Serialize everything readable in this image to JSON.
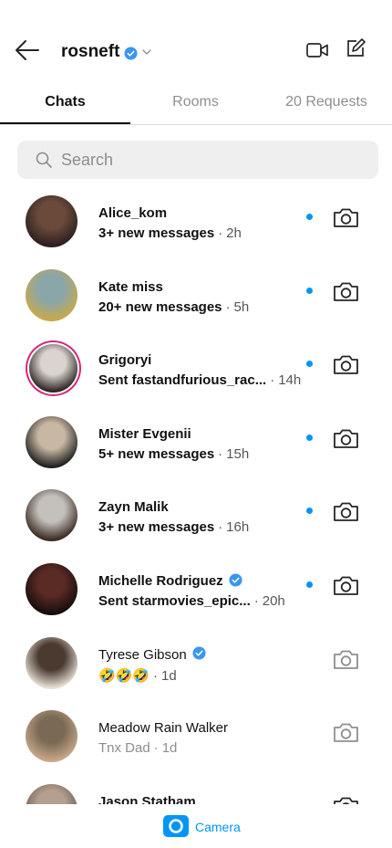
{
  "header": {
    "title": "rosneft",
    "back_icon": "arrow-left-icon",
    "video_icon": "video-camera-icon",
    "compose_icon": "compose-icon"
  },
  "tabs": [
    {
      "label": "Chats",
      "active": true
    },
    {
      "label": "Rooms",
      "active": false
    },
    {
      "label": "20 Requests",
      "active": false
    }
  ],
  "search": {
    "placeholder": "Search",
    "value": ""
  },
  "chats": [
    {
      "name": "Alice_kom",
      "verified": false,
      "preview": "3+ new messages",
      "time": "2h",
      "unread": true,
      "bold": true,
      "story": false,
      "avatar_colors": [
        "#6b4a3a",
        "#2b2020"
      ]
    },
    {
      "name": "Kate miss",
      "verified": false,
      "preview": "20+ new messages",
      "time": "5h",
      "unread": true,
      "bold": true,
      "story": false,
      "avatar_colors": [
        "#8aa6a8",
        "#c9a94a"
      ]
    },
    {
      "name": "Grigoryi",
      "verified": false,
      "preview": "Sent fastandfurious_rac...",
      "time": "14h",
      "unread": true,
      "bold": true,
      "story": true,
      "avatar_colors": [
        "#d9d4d0",
        "#2c2522"
      ]
    },
    {
      "name": "Mister Evgenii",
      "verified": false,
      "preview": "5+ new messages",
      "time": "15h",
      "unread": true,
      "bold": true,
      "story": false,
      "avatar_colors": [
        "#c8b7a3",
        "#1f1f1f"
      ]
    },
    {
      "name": "Zayn Malik",
      "verified": false,
      "preview": "3+ new messages",
      "time": "16h",
      "unread": true,
      "bold": true,
      "story": false,
      "avatar_colors": [
        "#c4c0bc",
        "#3a2a22"
      ]
    },
    {
      "name": "Michelle Rodriguez",
      "verified": true,
      "preview": "Sent starmovies_epic...",
      "time": "20h",
      "unread": true,
      "bold": true,
      "story": false,
      "avatar_colors": [
        "#5a2a24",
        "#150d0c"
      ]
    },
    {
      "name": "Tyrese Gibson",
      "verified": true,
      "preview": "🤣🤣🤣",
      "time": "1d",
      "unread": false,
      "bold": false,
      "story": false,
      "avatar_colors": [
        "#4a3a30",
        "#e8e0d6"
      ]
    },
    {
      "name": "Meadow Rain Walker",
      "verified": false,
      "preview": "Tnx Dad",
      "time": "1d",
      "unread": false,
      "bold": false,
      "story": false,
      "muted": true,
      "avatar_colors": [
        "#7a6a55",
        "#c9a88a"
      ]
    },
    {
      "name": "Jason Statham",
      "verified": false,
      "preview": "",
      "time": "",
      "unread": false,
      "bold": true,
      "story": false,
      "avatar_colors": [
        "#b5a090",
        "#6a5a4e"
      ]
    }
  ],
  "bottom": {
    "camera_label": "Camera",
    "camera_icon": "camera-icon"
  },
  "colors": {
    "accent": "#0095f6",
    "story_ring": "#d62976"
  }
}
